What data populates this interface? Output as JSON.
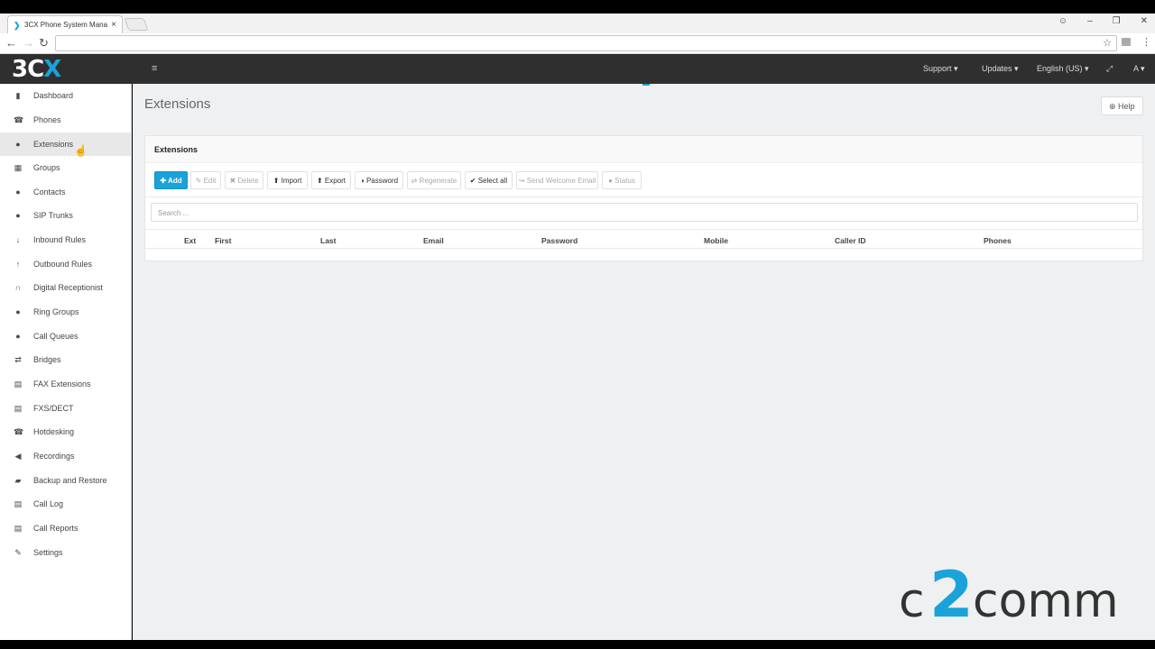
{
  "browser": {
    "tab_title": "3CX Phone System Mana",
    "tab_close": "×",
    "url": "",
    "back": "←",
    "forward": "→",
    "reload": "↻",
    "star": "☆",
    "menu": "⋮",
    "window_controls": [
      "☺",
      "–",
      "❐",
      "✕"
    ]
  },
  "header": {
    "logo_main": "3C",
    "logo_x": "X",
    "menu_icon": "≡",
    "items": [
      "Support ▾",
      "Updates ▾",
      "English (US) ▾",
      "⤢",
      "A ▾"
    ]
  },
  "sidebar": {
    "items": [
      {
        "label": "Dashboard",
        "icon": "bar-chart-icon",
        "glyph": "▮"
      },
      {
        "label": "Phones",
        "icon": "phone-icon",
        "glyph": "☎"
      },
      {
        "label": "Extensions",
        "icon": "user-icon",
        "glyph": "●",
        "active": true
      },
      {
        "label": "Groups",
        "icon": "grid-icon",
        "glyph": "▦"
      },
      {
        "label": "Contacts",
        "icon": "contact-icon",
        "glyph": "●"
      },
      {
        "label": "SIP Trunks",
        "icon": "globe-icon",
        "glyph": "●"
      },
      {
        "label": "Inbound Rules",
        "icon": "arrow-down-icon",
        "glyph": "↓"
      },
      {
        "label": "Outbound Rules",
        "icon": "arrow-up-icon",
        "glyph": "↑"
      },
      {
        "label": "Digital Receptionist",
        "icon": "headset-icon",
        "glyph": "∩"
      },
      {
        "label": "Ring Groups",
        "icon": "users-icon",
        "glyph": "●"
      },
      {
        "label": "Call Queues",
        "icon": "users-icon",
        "glyph": "●"
      },
      {
        "label": "Bridges",
        "icon": "exchange-icon",
        "glyph": "⇄"
      },
      {
        "label": "FAX Extensions",
        "icon": "fax-icon",
        "glyph": "▤"
      },
      {
        "label": "FXS/DECT",
        "icon": "fax-icon",
        "glyph": "▤"
      },
      {
        "label": "Hotdesking",
        "icon": "phone-icon",
        "glyph": "☎"
      },
      {
        "label": "Recordings",
        "icon": "speaker-icon",
        "glyph": "◀"
      },
      {
        "label": "Backup and Restore",
        "icon": "folder-icon",
        "glyph": "▰"
      },
      {
        "label": "Call Log",
        "icon": "list-icon",
        "glyph": "▤"
      },
      {
        "label": "Call Reports",
        "icon": "report-icon",
        "glyph": "▤"
      },
      {
        "label": "Settings",
        "icon": "wrench-icon",
        "glyph": "✎"
      }
    ]
  },
  "main": {
    "page_title": "Extensions",
    "help_label": "⊕ Help",
    "panel_title": "Extensions",
    "buttons": [
      {
        "label": "✚ Add",
        "state": "primary",
        "name": "add-button"
      },
      {
        "label": "✎ Edit",
        "state": "disabled",
        "name": "edit-button"
      },
      {
        "label": "✖ Delete",
        "state": "disabled",
        "name": "delete-button"
      },
      {
        "label": "⬆ Import",
        "state": "enabled",
        "name": "import-button"
      },
      {
        "label": "⬆ Export",
        "state": "enabled",
        "name": "export-button"
      },
      {
        "label": "◑ Password",
        "state": "enabled",
        "name": "password-button"
      },
      {
        "label": "⇄ Regenerate",
        "state": "disabled",
        "name": "regenerate-button"
      },
      {
        "label": "✔ Select all",
        "state": "enabled",
        "name": "select-all-button"
      },
      {
        "label": "↪ Send Welcome Email",
        "state": "disabled",
        "name": "send-welcome-email-button"
      },
      {
        "label": "● Status",
        "state": "disabled",
        "name": "status-button"
      }
    ],
    "search_placeholder": "Search ...",
    "columns": [
      "Ext",
      "First",
      "Last",
      "Email",
      "Password",
      "Mobile",
      "Caller ID",
      "Phones"
    ]
  },
  "watermark": {
    "prefix": "c",
    "digit": "2",
    "suffix": "comm",
    "digit_color": "#1aa3d9"
  }
}
